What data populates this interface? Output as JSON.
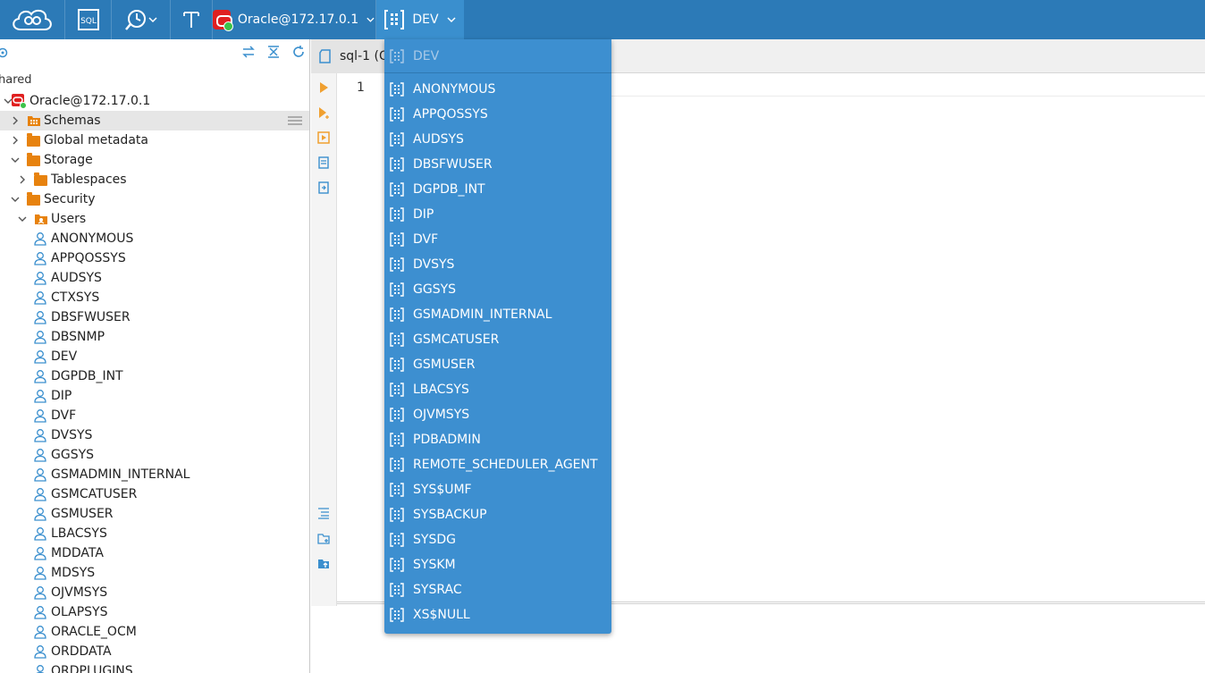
{
  "toolbar": {
    "connection_label": "Oracle@172.17.0.1",
    "schema_label": "DEV",
    "sql_label": "SQL"
  },
  "navigator": {
    "section_label": "hared",
    "tree": [
      {
        "label": "Oracle@172.17.0.1",
        "type": "connection",
        "depth": 0,
        "expanded": true
      },
      {
        "label": "Schemas",
        "type": "schemas-folder",
        "depth": 1,
        "expanded": false,
        "selected": true
      },
      {
        "label": "Global metadata",
        "type": "folder",
        "depth": 1,
        "expanded": false
      },
      {
        "label": "Storage",
        "type": "folder",
        "depth": 1,
        "expanded": true
      },
      {
        "label": "Tablespaces",
        "type": "folder",
        "depth": 2,
        "expanded": false
      },
      {
        "label": "Security",
        "type": "folder",
        "depth": 1,
        "expanded": true
      },
      {
        "label": "Users",
        "type": "users-folder",
        "depth": 2,
        "expanded": true
      }
    ],
    "users": [
      "ANONYMOUS",
      "APPQOSSYS",
      "AUDSYS",
      "CTXSYS",
      "DBSFWUSER",
      "DBSNMP",
      "DEV",
      "DGPDB_INT",
      "DIP",
      "DVF",
      "DVSYS",
      "GGSYS",
      "GSMADMIN_INTERNAL",
      "GSMCATUSER",
      "GSMUSER",
      "LBACSYS",
      "MDDATA",
      "MDSYS",
      "OJVMSYS",
      "OLAPSYS",
      "ORACLE_OCM",
      "ORDDATA",
      "ORDPLUGINS"
    ]
  },
  "editor": {
    "tab_label": "sql-1 (O",
    "line_number": "1"
  },
  "schema_dropdown": {
    "current": "DEV",
    "items": [
      "ANONYMOUS",
      "APPQOSSYS",
      "AUDSYS",
      "DBSFWUSER",
      "DGPDB_INT",
      "DIP",
      "DVF",
      "DVSYS",
      "GGSYS",
      "GSMADMIN_INTERNAL",
      "GSMCATUSER",
      "GSMUSER",
      "LBACSYS",
      "OJVMSYS",
      "PDBADMIN",
      "REMOTE_SCHEDULER_AGENT",
      "SYS$UMF",
      "SYSBACKUP",
      "SYSDG",
      "SYSKM",
      "SYSRAC",
      "XS$NULL"
    ]
  },
  "colors": {
    "toolbar": "#2c7ab7",
    "dropdown": "#3d8fd0",
    "folder": "#e7820e",
    "user_icon": "#3a8fce"
  }
}
